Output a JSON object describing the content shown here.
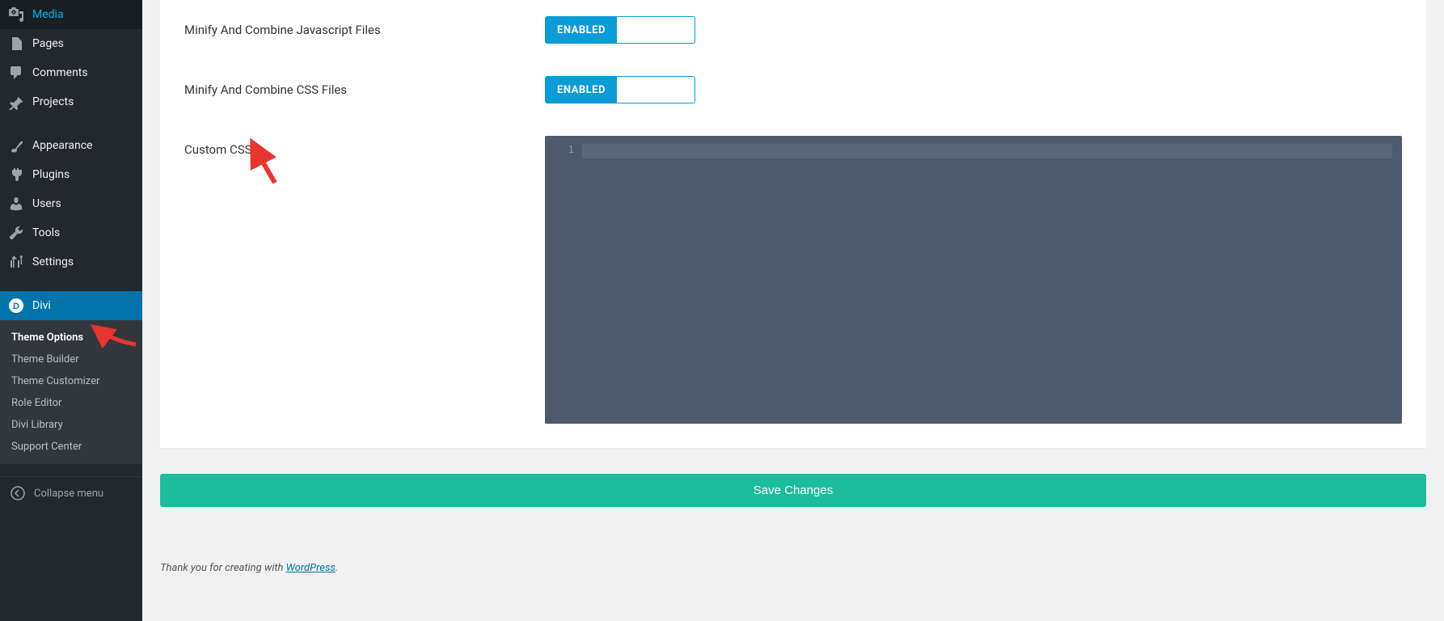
{
  "sidebar": {
    "items": [
      {
        "label": "Media",
        "icon": "media-icon"
      },
      {
        "label": "Pages",
        "icon": "page-icon"
      },
      {
        "label": "Comments",
        "icon": "comment-icon"
      },
      {
        "label": "Projects",
        "icon": "pin-icon"
      }
    ],
    "items2": [
      {
        "label": "Appearance",
        "icon": "brush-icon"
      },
      {
        "label": "Plugins",
        "icon": "plug-icon"
      },
      {
        "label": "Users",
        "icon": "user-icon"
      },
      {
        "label": "Tools",
        "icon": "wrench-icon"
      },
      {
        "label": "Settings",
        "icon": "sliders-icon"
      }
    ],
    "divi": {
      "label": "Divi",
      "icon": "divi-icon"
    },
    "submenu": [
      "Theme Options",
      "Theme Builder",
      "Theme Customizer",
      "Role Editor",
      "Divi Library",
      "Support Center"
    ],
    "collapse": "Collapse menu"
  },
  "options": {
    "minify_js": {
      "label": "Minify And Combine Javascript Files",
      "state": "ENABLED"
    },
    "minify_css": {
      "label": "Minify And Combine CSS Files",
      "state": "ENABLED"
    },
    "custom_css": {
      "label": "Custom CSS",
      "line1": "1"
    }
  },
  "save_label": "Save Changes",
  "footer": {
    "prefix": "Thank you for creating with ",
    "link": "WordPress",
    "suffix": "."
  }
}
